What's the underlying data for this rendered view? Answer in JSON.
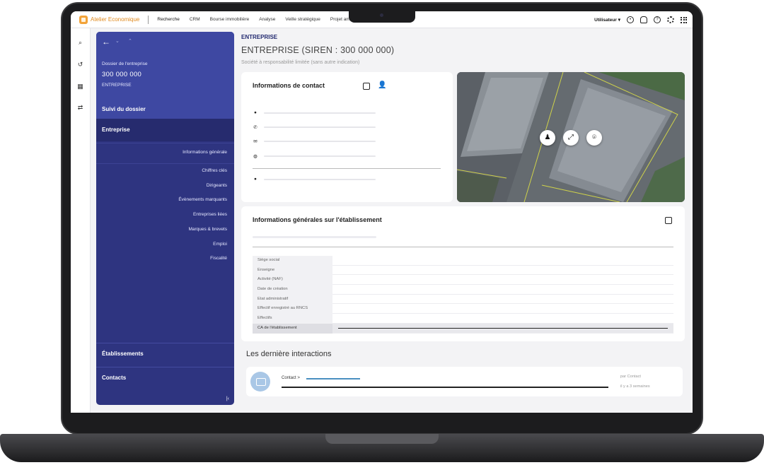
{
  "app": {
    "name": "Atelier Economique",
    "nav": [
      "Recherche",
      "CRM",
      "Bourse immobilière",
      "Analyse",
      "Veille stratégique",
      "Projet amé"
    ],
    "user": "Utilisateur"
  },
  "sidebar": {
    "file_label": "Dossier de l'entreprise",
    "file_number": "300 000 000",
    "file_type": "ENTREPRISE",
    "suivi": "Suivi du dossier",
    "entreprise": "Entreprise",
    "items": [
      "Informations générale",
      "Chiffres clés",
      "Dirigeants",
      "Évènements marquants",
      "Entreprises liées",
      "Marques & brevets",
      "Emploi",
      "Fiscalité"
    ],
    "etablissements": "Établissements",
    "contacts": "Contacts"
  },
  "header": {
    "kicker": "ENTREPRISE",
    "title": "ENTREPRISE (SIREN : 300 000 000)",
    "subtitle": "Société à responsabilité limitée (sans autre indication)"
  },
  "contact_card": {
    "title": "Informations de contact",
    "icons": [
      "location-icon",
      "phone-icon",
      "mail-icon",
      "globe-icon",
      "person-icon"
    ]
  },
  "etab_card": {
    "title": "Informations générales sur l'établissement",
    "rows": [
      "Siège social",
      "Enseigne",
      "Activité (NAF)",
      "Date de création",
      "Etat administratif",
      "Effectif enregistré au RNCS",
      "Effectifs",
      "CA de l'établissement"
    ]
  },
  "interactions": {
    "title": "Les dernière interactions",
    "contact_label": "Contact >",
    "by": "par Contact",
    "ago": "il y a 3 semaines"
  }
}
